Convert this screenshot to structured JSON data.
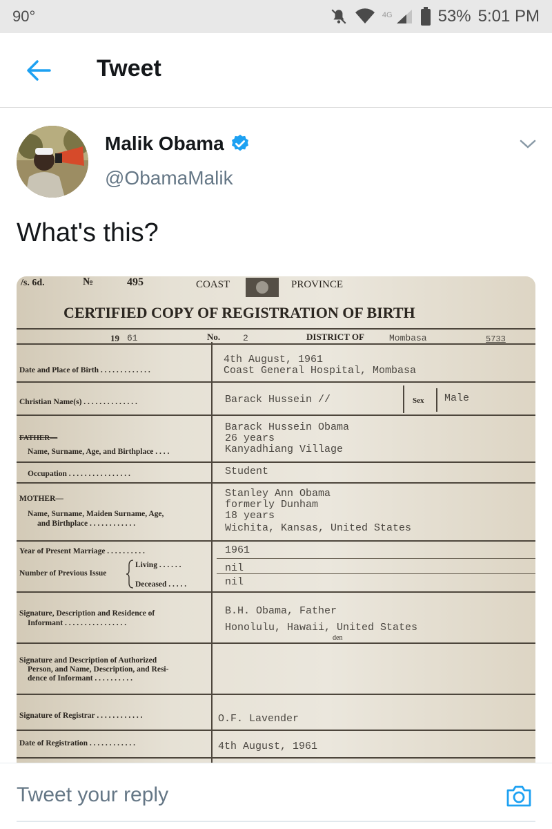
{
  "status_bar": {
    "temperature": "90°",
    "network": "4G",
    "battery": "53%",
    "time": "5:01 PM"
  },
  "header": {
    "title": "Tweet"
  },
  "tweet": {
    "author_name": "Malik Obama",
    "handle": "@ObamaMalik",
    "text": "What's this?"
  },
  "certificate": {
    "top_left": "/s. 6d.",
    "number_label": "№",
    "number": "495",
    "coast": "COAST",
    "province": "PROVINCE",
    "title": "CERTIFIED  COPY  OF  REGISTRATION  OF  BIRTH",
    "year_prefix": "19",
    "year_suffix": "61",
    "no_label": "No.",
    "no_value": "2",
    "district_label": "DISTRICT  OF",
    "district_value": "Mombasa",
    "ref": "5733",
    "dob_label": "Date and Place of Birth . . .  . .  . .  . .  . .  . .",
    "dob_value_1": "4th August, 1961",
    "dob_value_2": "Coast General Hospital, Mombasa",
    "christian_label": "Christian Name(s) . .  . .  . .  . .  . .  . .  . .",
    "christian_value": "Barack Hussein //",
    "sex_label": "Sex",
    "sex_value": "Male",
    "father_label": "FATHER—",
    "father_sub": "Name, Surname, Age, and Birthplace . .  . .",
    "father_value_1": "Barack Hussein Obama",
    "father_value_2": "26 years",
    "father_value_3": "Kanyadhiang Village",
    "occupation_label": "Occupation . .  . .  . .  . .  . .  . .  . .  . .",
    "occupation_value": "Student",
    "mother_label": "MOTHER—",
    "mother_sub_1": "Name,  Surname,  Maiden  Surname,  Age,",
    "mother_sub_2": "and Birthplace . .  . .  . .  . .  . .  . .",
    "mother_value_1": "Stanley Ann Obama",
    "mother_value_2": "formerly Dunham",
    "mother_value_3": "18 years",
    "mother_value_4": "Wichita, Kansas, United States",
    "marriage_label": "Year of Present Marriage . .  . .  . .  . .  . .",
    "marriage_value": "1961",
    "issue_label": "Number of Previous Issue",
    "living_label": "Living . .  . .  . .",
    "living_value": "nil",
    "deceased_label": "Deceased . .  . .  .",
    "deceased_value": "nil",
    "informant_label_1": "Signature,  Description  and  Residence  of",
    "informant_label_2": "Informant . .  . .  . .  . .  . .  . .  . .  . .",
    "informant_value_1": "B.H. Obama, Father",
    "informant_value_2": "Honolulu, Hawaii, United States",
    "informant_value_3": "den",
    "authorized_1": "Signature  and  Description  of  Authorized",
    "authorized_2": "Person,  and  Name,  Description,  and  Resi-",
    "authorized_3": "dence  of  Informant . .  . .  . .  . .  . .",
    "registrar_label": "Signature of Registrar . .  . .  . .  . .  . .  . .",
    "registrar_value": "O.F. Lavender",
    "registration_label": "Date of Registration . .  . .  . .  . .  . .  . .",
    "registration_value": "4th August, 1961"
  },
  "reply": {
    "placeholder": "Tweet your reply"
  },
  "colors": {
    "twitter_blue": "#1da1f2",
    "handle_gray": "#657786",
    "paper": "#e6e1d5"
  },
  "icons": [
    "back-arrow-icon",
    "verified-icon",
    "chevron-down-icon",
    "camera-icon",
    "mute-icon",
    "wifi-icon",
    "signal-icon",
    "battery-icon"
  ]
}
